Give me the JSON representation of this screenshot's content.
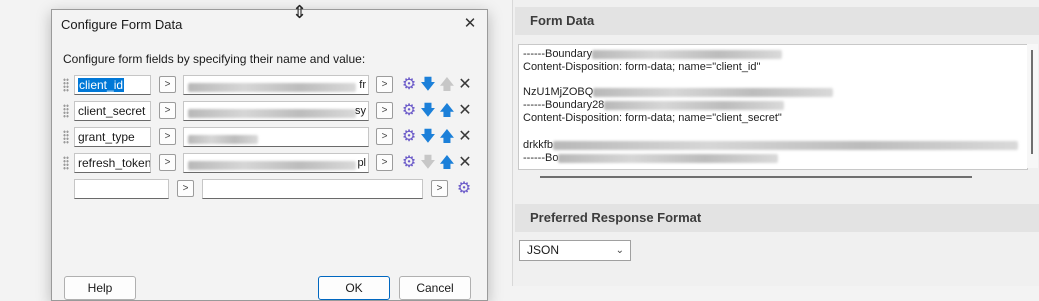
{
  "right": {
    "form_data_header": "Form Data",
    "form_data_lines": [
      {
        "text": "------Boundary",
        "blur": 190
      },
      {
        "text": "Content-Disposition: form-data; name=\"client_id\"",
        "blur": 0
      },
      {
        "text": "",
        "blur": 0
      },
      {
        "text": "NzU1MjZOBQ",
        "blur": 240
      },
      {
        "text": "------Boundary28",
        "blur": 190
      },
      {
        "text": "Content-Disposition: form-data; name=\"client_secret\"",
        "blur": 0
      },
      {
        "text": "",
        "blur": 0
      },
      {
        "text": "drkkfb",
        "blur": 470
      },
      {
        "text": "------Bo",
        "blur": 220
      }
    ],
    "preferred_header": "Preferred Response Format",
    "format_value": "JSON"
  },
  "dialog": {
    "title": "Configure Form Data",
    "close_glyph": "✕",
    "description": "Configure form fields by specifying their name and value:",
    "fields": [
      {
        "name": "client_id",
        "selected": true,
        "down_enabled": true,
        "up_enabled": false,
        "tail": "fr"
      },
      {
        "name": "client_secret",
        "selected": false,
        "down_enabled": true,
        "up_enabled": true,
        "tail": "sy"
      },
      {
        "name": "grant_type",
        "selected": false,
        "down_enabled": true,
        "up_enabled": true,
        "tail": ""
      },
      {
        "name": "refresh_token",
        "selected": false,
        "down_enabled": false,
        "up_enabled": true,
        "tail": "pl"
      }
    ],
    "new_row": {
      "name": "",
      "value": ""
    },
    "buttons": {
      "help": "Help",
      "ok": "OK",
      "cancel": "Cancel"
    },
    "arrow_glyph": ">",
    "icons": {
      "gear": "gear-icon",
      "down": "arrow-down-icon",
      "up": "arrow-up-icon",
      "delete": "delete-icon"
    }
  }
}
